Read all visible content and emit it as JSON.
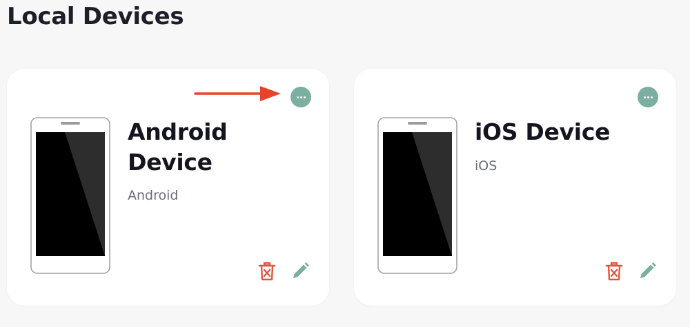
{
  "page": {
    "title": "Local Devices"
  },
  "devices": [
    {
      "name": "Android Device",
      "platform": "Android",
      "menu_icon": "more-horizontal-icon",
      "delete_icon": "trash-icon",
      "edit_icon": "pencil-icon"
    },
    {
      "name": "iOS Device",
      "platform": "iOS",
      "menu_icon": "more-horizontal-icon",
      "delete_icon": "trash-icon",
      "edit_icon": "pencil-icon"
    }
  ],
  "colors": {
    "accent": "#7aafa1",
    "danger": "#e2553a",
    "annotation_arrow": "#e8432a",
    "title": "#1e1e28",
    "subtitle": "#6b6f7b",
    "card": "#ffffff",
    "background": "#f7f7f8"
  }
}
